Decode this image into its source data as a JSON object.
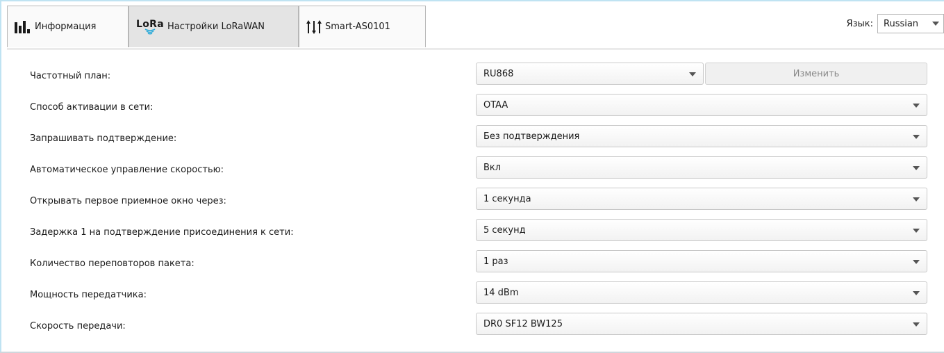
{
  "tabs": [
    {
      "label": "Информация",
      "icon": "bar-chart-icon",
      "active": false
    },
    {
      "label": "Настройки LoRaWAN",
      "icon": "lora-logo-icon",
      "logo_text": "LoRa",
      "active": true
    },
    {
      "label": "Smart-AS0101",
      "icon": "sliders-icon",
      "active": false
    }
  ],
  "language": {
    "label": "Язык:",
    "value": "Russian"
  },
  "form": {
    "change_button": "Изменить",
    "rows": [
      {
        "label": "Частотный план:",
        "value": "RU868"
      },
      {
        "label": "Способ активации в сети:",
        "value": "OTAA"
      },
      {
        "label": "Запрашивать подтверждение:",
        "value": "Без подтверждения"
      },
      {
        "label": "Автоматическое управление скоростью:",
        "value": "Вкл"
      },
      {
        "label": "Открывать первое приемное окно через:",
        "value": "1 секунда"
      },
      {
        "label": "Задержка 1 на подтверждение присоединения к сети:",
        "value": "5 секунд"
      },
      {
        "label": "Количество переповторов пакета:",
        "value": "1 раз"
      },
      {
        "label": "Мощность передатчика:",
        "value": "14 dBm"
      },
      {
        "label": "Скорость передачи:",
        "value": "DR0 SF12 BW125"
      }
    ]
  },
  "colors": {
    "accent_edge": "#bfe3f2",
    "lora_waves": "#29a9d8",
    "active_tab": "#e4e4e4"
  }
}
